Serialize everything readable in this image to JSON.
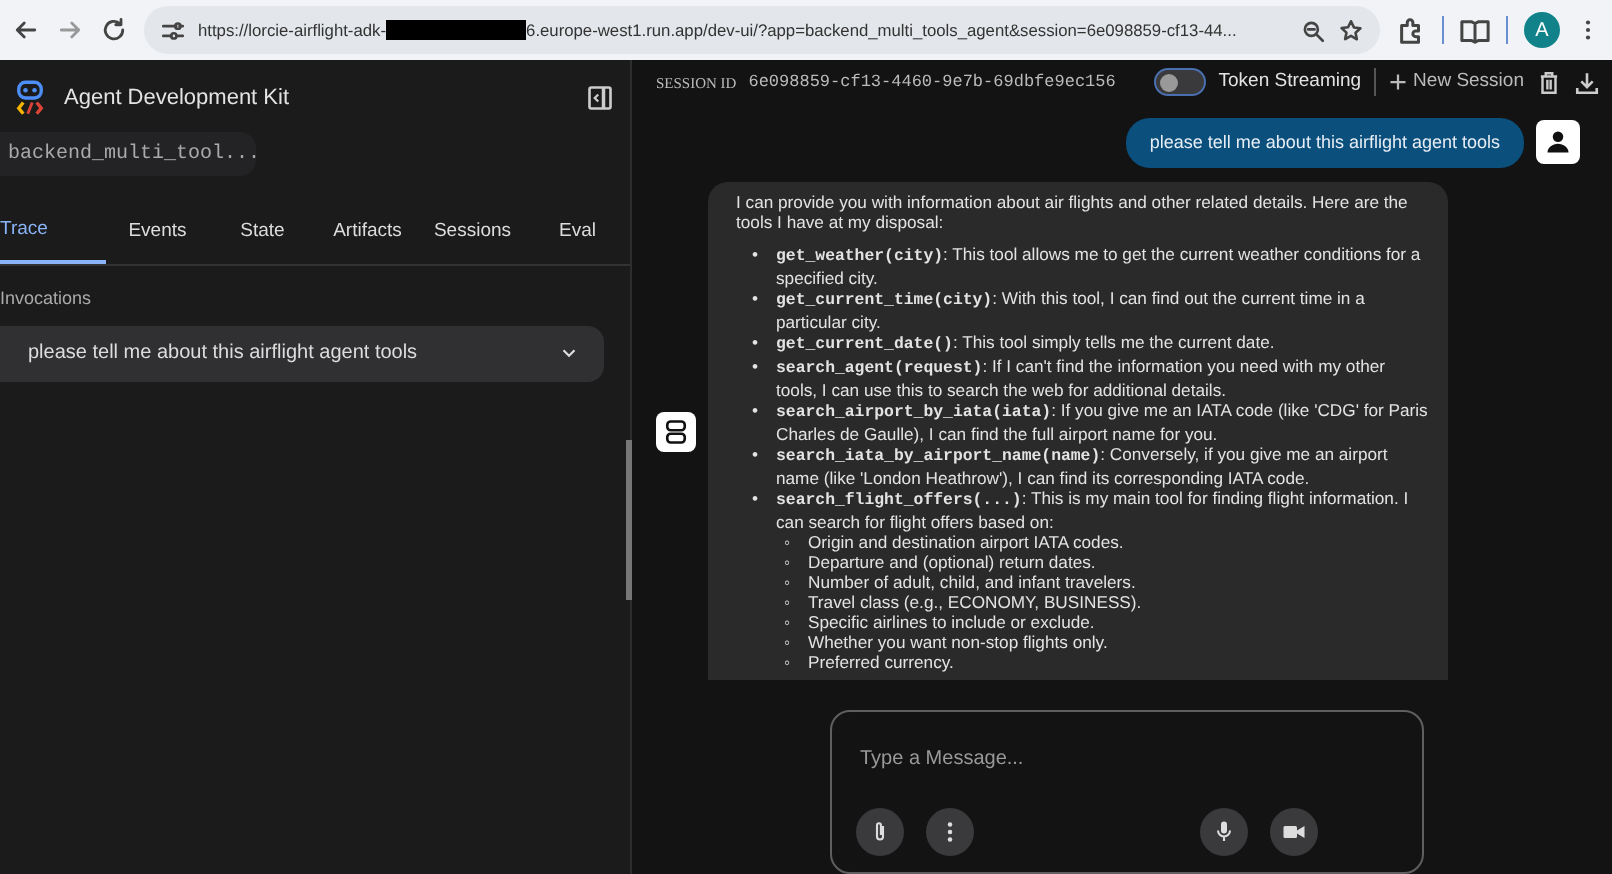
{
  "browser": {
    "url_start": "https://lorcie-airflight-adk-",
    "url_end": "6.europe-west1.run.app/dev-ui/?app=backend_multi_tools_agent&session=6e098859-cf13-44...",
    "profile": "A"
  },
  "sidebar": {
    "title": "Agent Development Kit",
    "app_select": "backend_multi_tool...",
    "tabs": [
      {
        "label": "Trace",
        "selected": true
      },
      {
        "label": "Events",
        "selected": false
      },
      {
        "label": "State",
        "selected": false
      },
      {
        "label": "Artifacts",
        "selected": false
      },
      {
        "label": "Sessions",
        "selected": false
      },
      {
        "label": "Eval",
        "selected": false
      }
    ],
    "section_label": "Invocations",
    "invocations": [
      {
        "label": "please tell me about this airflight agent tools",
        "expanded": false
      }
    ]
  },
  "header": {
    "session_label": "SESSION ID",
    "session_id": "6e098859-cf13-4460-9e7b-69dbfe9ec156",
    "token_streaming": {
      "label": "Token Streaming",
      "on": false
    },
    "new_session": "New Session"
  },
  "messages": [
    {
      "kind": "user",
      "text": "please tell me about this airflight agent tools"
    },
    {
      "kind": "bot",
      "intro": "I can provide you with information about air flights and other related details. Here are the tools I have at my disposal:",
      "items": [
        {
          "marker": "•",
          "code": "get_weather(city)",
          "text": ": This tool allows me to get the current weather conditions for a specified city."
        },
        {
          "marker": "•",
          "code": "get_current_time(city)",
          "text": ": With this tool, I can find out the current time in a particular city."
        },
        {
          "marker": "•",
          "code": "get_current_date()",
          "text": ": This tool simply tells me the current date."
        },
        {
          "marker": "•",
          "code": "search_agent(request)",
          "text": ": If I can't find the information you need with my other tools, I can use this to search the web for additional details."
        },
        {
          "marker": "•",
          "code": "search_airport_by_iata(iata)",
          "text": ": If you give me an IATA code (like 'CDG' for Paris Charles de Gaulle), I can find the full airport name for you."
        },
        {
          "marker": "•",
          "code": "search_iata_by_airport_name(name)",
          "text": ": Conversely, if you give me an airport name (like 'London Heathrow'), I can find its corresponding IATA code."
        },
        {
          "marker": "•",
          "code": "search_flight_offers(...)",
          "text": ": This is my main tool for finding flight information. I can search for flight offers based on:",
          "children": [
            {
              "marker": "◦",
              "text": "Origin and destination airport IATA codes."
            },
            {
              "marker": "◦",
              "text": "Departure and (optional) return dates."
            },
            {
              "marker": "◦",
              "text": "Number of adult, child, and infant travelers."
            },
            {
              "marker": "◦",
              "text": "Travel class (e.g., ECONOMY, BUSINESS)."
            },
            {
              "marker": "◦",
              "text": "Specific airlines to include or exclude."
            },
            {
              "marker": "◦",
              "text": "Whether you want non-stop flights only."
            },
            {
              "marker": "◦",
              "text": "Preferred currency."
            }
          ]
        }
      ]
    }
  ],
  "composer": {
    "placeholder": "Type a Message..."
  }
}
